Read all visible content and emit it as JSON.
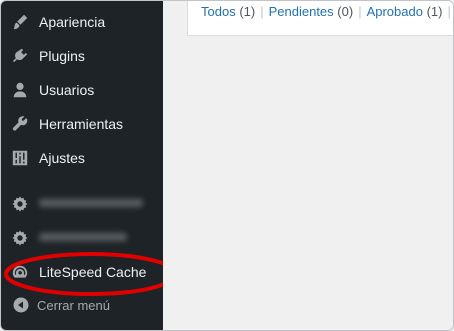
{
  "sidebar": {
    "items": [
      {
        "label": "Apariencia",
        "icon": "paintbrush-icon"
      },
      {
        "label": "Plugins",
        "icon": "plug-icon"
      },
      {
        "label": "Usuarios",
        "icon": "user-icon"
      },
      {
        "label": "Herramientas",
        "icon": "wrench-icon"
      },
      {
        "label": "Ajustes",
        "icon": "settings-sliders-icon"
      },
      {
        "label": "",
        "icon": "gear-icon"
      },
      {
        "label": "",
        "icon": "gear-icon"
      },
      {
        "label": "LiteSpeed Cache",
        "icon": "gauge-icon"
      }
    ],
    "collapse_label": "Cerrar menú",
    "highlight_color": "#e00000"
  },
  "filters": [
    {
      "label": "Todos",
      "count": "(1)"
    },
    {
      "label": "Pendientes",
      "count": "(0)"
    },
    {
      "label": "Aprobado",
      "count": "(1)"
    }
  ],
  "separator": "|"
}
